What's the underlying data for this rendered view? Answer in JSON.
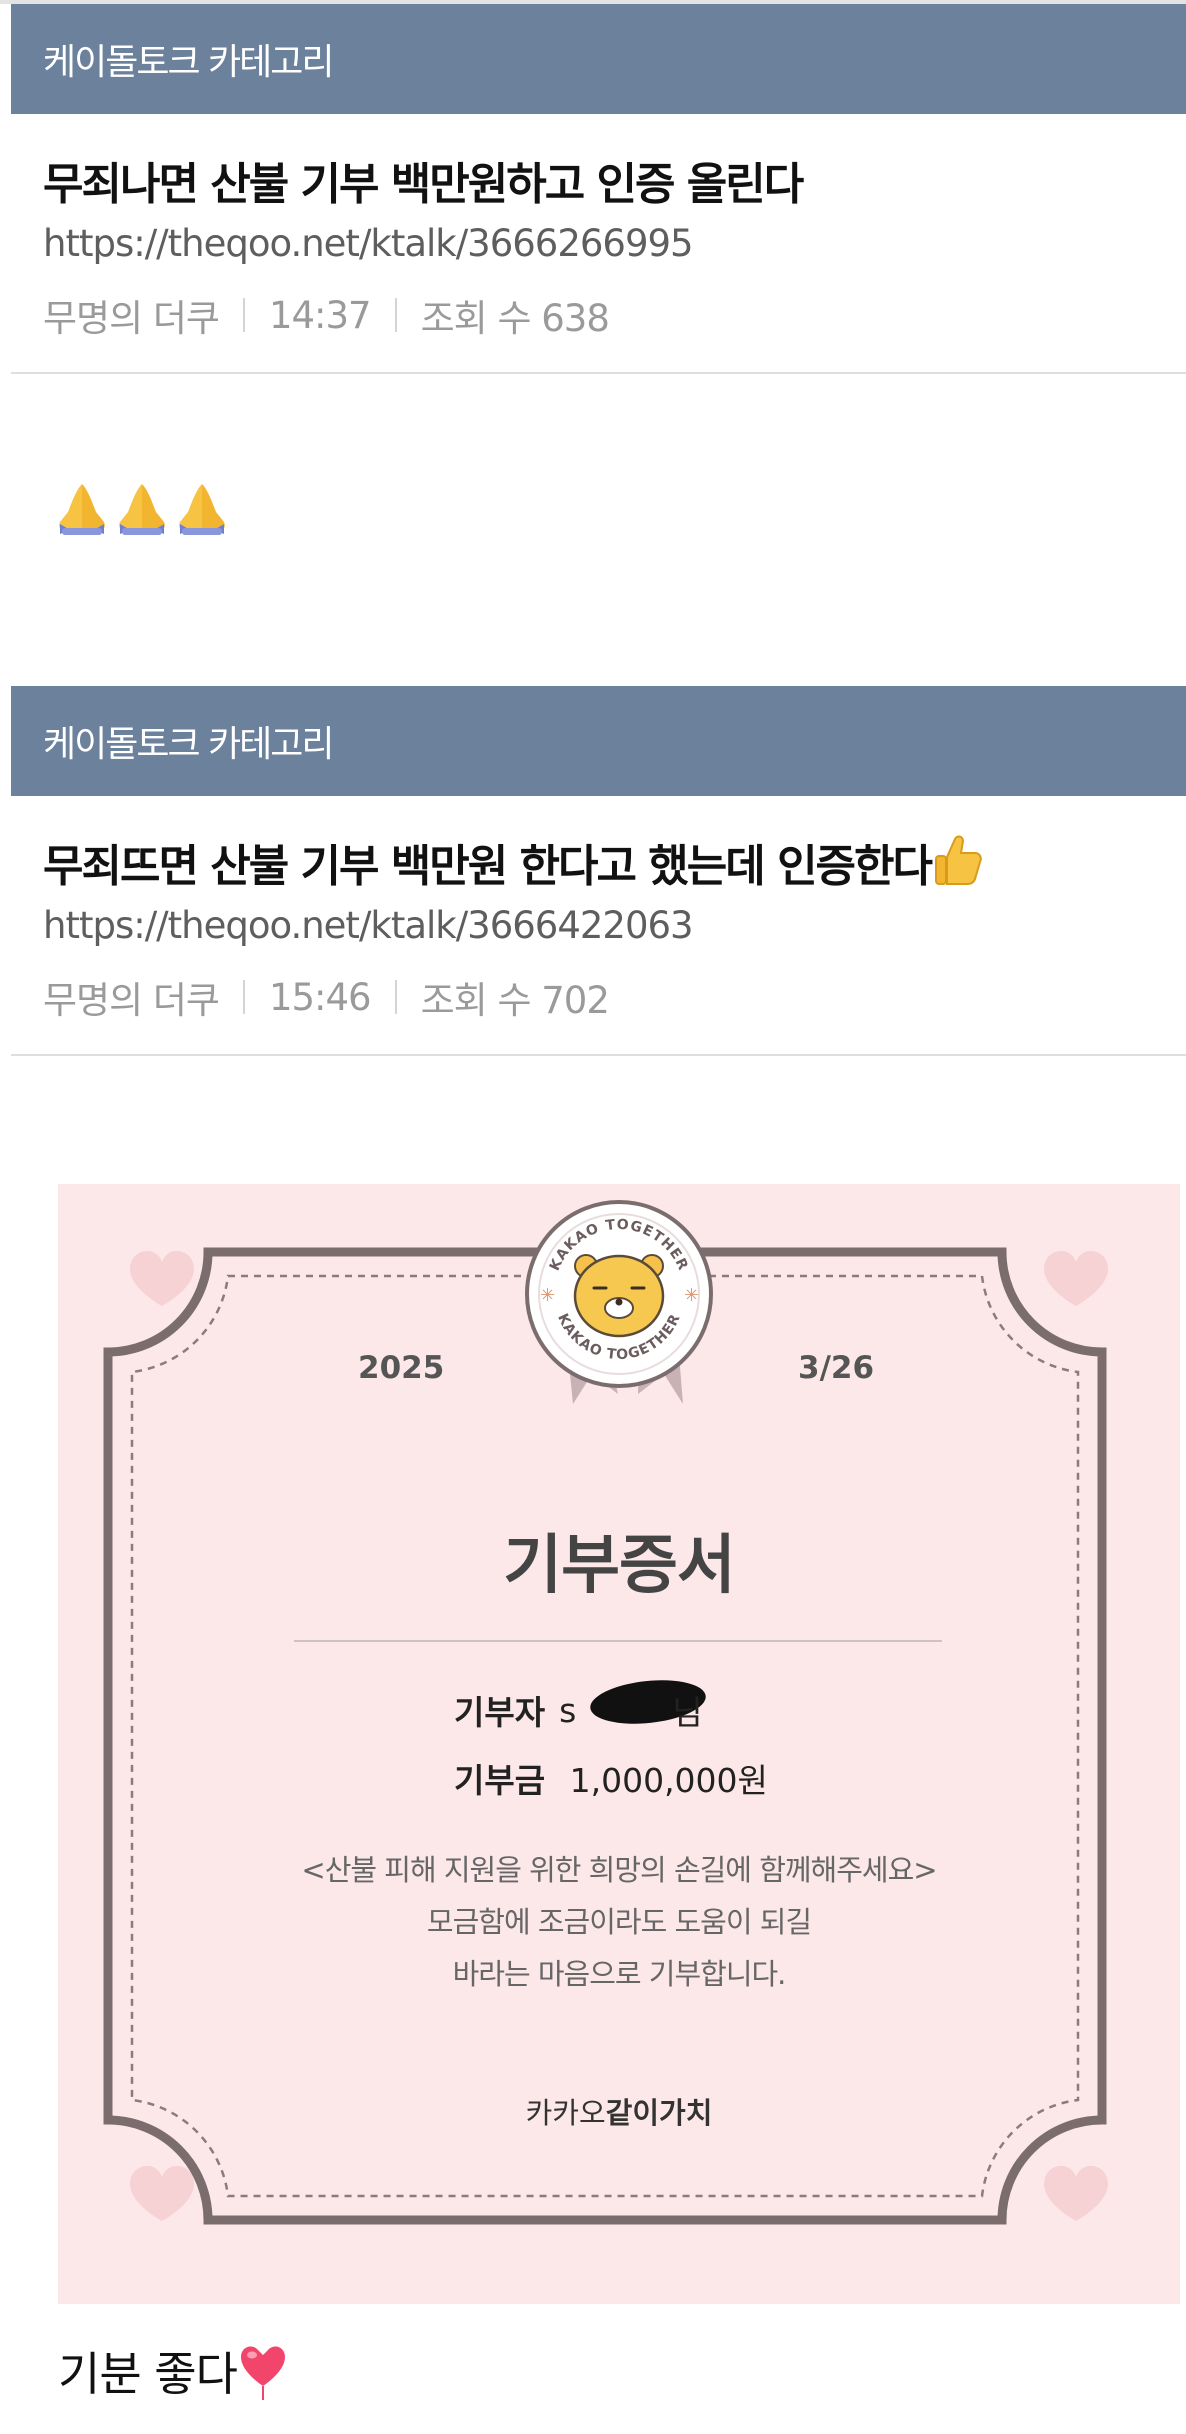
{
  "posts": [
    {
      "category": "케이돌토크 카테고리",
      "title": "무죄나면 산불 기부 백만원하고 인증 올린다",
      "url": "https://theqoo.net/ktalk/3666266995",
      "author": "무명의 더쿠",
      "time": "14:37",
      "views": "조회 수 638",
      "body_emoji": [
        "folded-hands-icon",
        "folded-hands-icon",
        "folded-hands-icon"
      ]
    },
    {
      "category": "케이돌토크 카테고리",
      "title": "무죄뜨면 산불 기부 백만원 한다고 했는데 인증한다",
      "title_emoji": "thumbs-up-icon",
      "url": "https://theqoo.net/ktalk/3666422063",
      "author": "무명의 더쿠",
      "time": "15:46",
      "views": "조회 수 702"
    }
  ],
  "certificate": {
    "badge_text": "KAKAO TOGETHER",
    "year": "2025",
    "date": "3/26",
    "heading": "기부증서",
    "donor_label": "기부자",
    "donor_visible": "s",
    "donor_suffix": "님",
    "amount_label": "기부금",
    "amount": "1,000,000원",
    "message_lines": [
      "<산불 피해 지원을 위한 희망의 손길에 함께해주세요>",
      "모금함에 조금이라도 도움이 되길",
      "바라는 마음으로 기부합니다."
    ],
    "brand_prefix": "카카오",
    "brand_bold": "같이가치",
    "colors": {
      "background": "#fde8e9",
      "frame": "#7b6d6e",
      "ribbon": "#c9b2b5"
    }
  },
  "closing": {
    "text": "기분 좋다",
    "emoji": "heart-icon"
  },
  "colors": {
    "category_bar": "#6c819c"
  }
}
